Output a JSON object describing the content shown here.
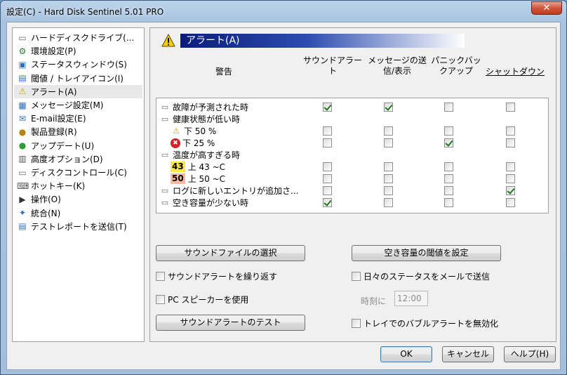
{
  "window": {
    "title": "設定(C)  -  Hard Disk Sentinel 5.01 PRO",
    "close_label": "✕"
  },
  "sidebar": {
    "items": [
      {
        "label": "ハードディスクドライブ(...",
        "icon": "hdd-icon",
        "glyph": "▭",
        "color": "#6a6a6a"
      },
      {
        "label": "環境設定(P)",
        "icon": "settings-icon",
        "glyph": "⚙",
        "color": "#2e7d32"
      },
      {
        "label": "ステータスウィンドウ(S)",
        "icon": "window-icon",
        "glyph": "▣",
        "color": "#2b6cc4"
      },
      {
        "label": "閾値 / トレイアイコン(I)",
        "icon": "tray-icon",
        "glyph": "▤",
        "color": "#2b6cc4"
      },
      {
        "label": "アラート(A)",
        "icon": "warning-icon",
        "glyph": "⚠",
        "color": "#c9a000"
      },
      {
        "label": "メッセージ設定(M)",
        "icon": "message-icon",
        "glyph": "▦",
        "color": "#2b6cc4"
      },
      {
        "label": "E-mail設定(E)",
        "icon": "email-icon",
        "glyph": "✉",
        "color": "#2b6cc4"
      },
      {
        "label": "製品登録(R)",
        "icon": "register-icon",
        "glyph": "●",
        "color": "#b8860b"
      },
      {
        "label": "アップデート(U)",
        "icon": "update-icon",
        "glyph": "●",
        "color": "#2e9d3a"
      },
      {
        "label": "高度オプション(D)",
        "icon": "advanced-icon",
        "glyph": "▥",
        "color": "#555555"
      },
      {
        "label": "ディスクコントロール(C)",
        "icon": "disk-control-icon",
        "glyph": "▭",
        "color": "#6a6a6a"
      },
      {
        "label": "ホットキー(K)",
        "icon": "hotkey-icon",
        "glyph": "⌨",
        "color": "#555555"
      },
      {
        "label": "操作(O)",
        "icon": "operation-icon",
        "glyph": "▶",
        "color": "#333333"
      },
      {
        "label": "統合(N)",
        "icon": "integration-icon",
        "glyph": "✦",
        "color": "#2b6cc4"
      },
      {
        "label": "テストレポートを送信(T)",
        "icon": "report-icon",
        "glyph": "▤",
        "color": "#2b6cc4"
      }
    ],
    "selected_index": 4
  },
  "panel": {
    "title": "アラート(A)",
    "columns": {
      "alert": "警告",
      "sound": "サウンドアラー\nト",
      "message": "メッセージの送\n信/表示",
      "backup": "パニックバッ\nクアップ",
      "shutdown": "シャットダウン"
    },
    "rows": [
      {
        "label": "故障が予測された時",
        "type": "main",
        "icon": "disk-icon",
        "checks": [
          true,
          true,
          false,
          false
        ]
      },
      {
        "label": "健康状態が低い時",
        "type": "header",
        "icon": "disk-icon"
      },
      {
        "label": "下 50 %",
        "type": "sub",
        "icon": "warning-icon",
        "checks": [
          false,
          false,
          false,
          false
        ]
      },
      {
        "label": "下 25 %",
        "type": "sub",
        "icon": "error-icon",
        "checks": [
          false,
          false,
          true,
          false
        ]
      },
      {
        "label": "温度が高すぎる時",
        "type": "header",
        "icon": "disk-icon"
      },
      {
        "label": "上 43 ~C",
        "type": "sub",
        "temp": "43",
        "temp_bg": "#ffe94a",
        "checks": [
          false,
          false,
          false,
          false
        ]
      },
      {
        "label": "上 50 ~C",
        "type": "sub",
        "temp": "50",
        "temp_bg": "#f7b9a0",
        "checks": [
          false,
          false,
          false,
          false
        ]
      },
      {
        "label": "ログに新しいエントリが追加さ...",
        "type": "main",
        "icon": "disk-icon",
        "checks": [
          false,
          false,
          false,
          true
        ]
      },
      {
        "label": "空き容量が少ない時",
        "type": "main",
        "icon": "disk-icon",
        "checks": [
          true,
          false,
          false,
          false
        ]
      }
    ],
    "buttons": {
      "select_sound": "サウンドファイルの選択",
      "free_space": "空き容量の閾値を設定",
      "test_sound": "サウンドアラートのテスト"
    },
    "options": {
      "repeat_sound": {
        "label": "サウンドアラートを繰り返す",
        "checked": false
      },
      "pc_speaker": {
        "label": "PC スピーカーを使用",
        "checked": false
      },
      "daily_status": {
        "label": "日々のステータスをメールで送信",
        "checked": false
      },
      "time_label": "時刻に",
      "time_value": "12:00",
      "disable_bubble": {
        "label": "トレイでのバブルアラートを無効化",
        "checked": false
      }
    }
  },
  "footer": {
    "ok": "OK",
    "cancel": "キャンセル",
    "help": "ヘルプ(H)"
  }
}
